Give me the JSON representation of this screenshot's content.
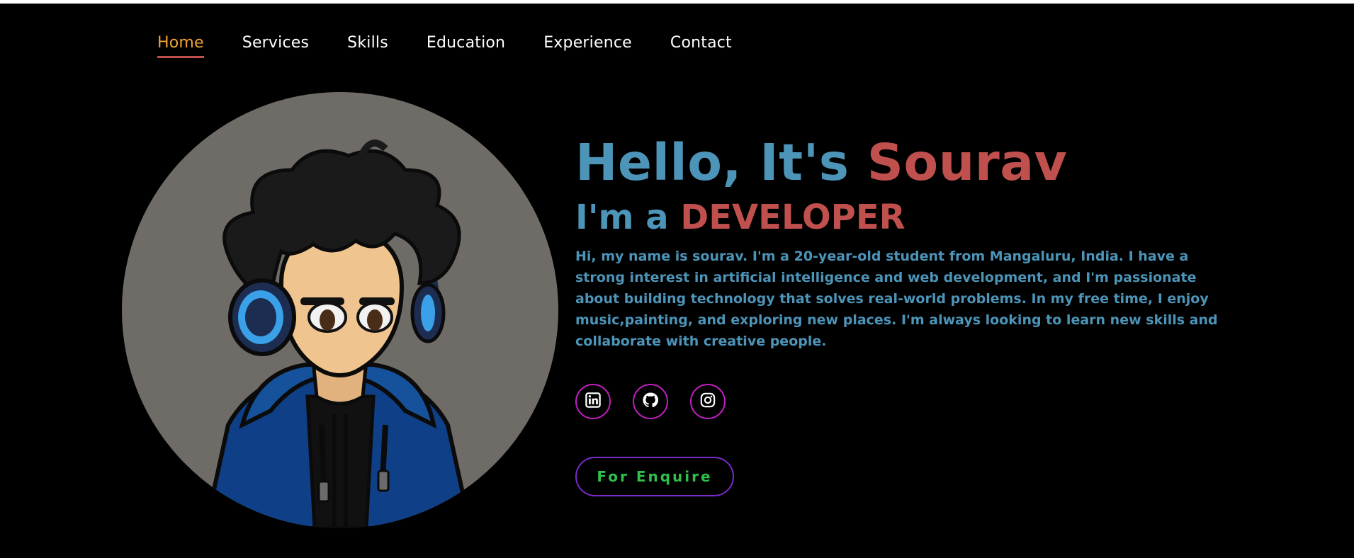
{
  "nav": {
    "items": [
      {
        "label": "Home",
        "active": true
      },
      {
        "label": "Services",
        "active": false
      },
      {
        "label": "Skills",
        "active": false
      },
      {
        "label": "Education",
        "active": false
      },
      {
        "label": "Experience",
        "active": false
      },
      {
        "label": "Contact",
        "active": false
      }
    ]
  },
  "hero": {
    "greeting": "Hello, It's",
    "name": "Sourav",
    "role_prefix": "I'm a",
    "role": "DEVELOPER",
    "bio": "Hi, my name is sourav. I'm a 20-year-old student from Mangaluru, India. I have a strong interest in artificial intelligence and web development, and I'm passionate about building technology that solves real-world problems. In my free time, I enjoy music,painting, and exploring new places. I'm always looking to learn new skills and collaborate with creative people."
  },
  "socials": [
    {
      "icon": "linkedin-icon"
    },
    {
      "icon": "github-icon"
    },
    {
      "icon": "instagram-icon"
    }
  ],
  "cta": {
    "label": "For Enquire"
  },
  "colors": {
    "background": "#000000",
    "accent_blue": "#4c94b8",
    "accent_red": "#c0504d",
    "nav_active": "#f0a23a",
    "social_border": "#c21fc2",
    "cta_text": "#2fbf4d",
    "cta_border": "#7a2ac8"
  }
}
